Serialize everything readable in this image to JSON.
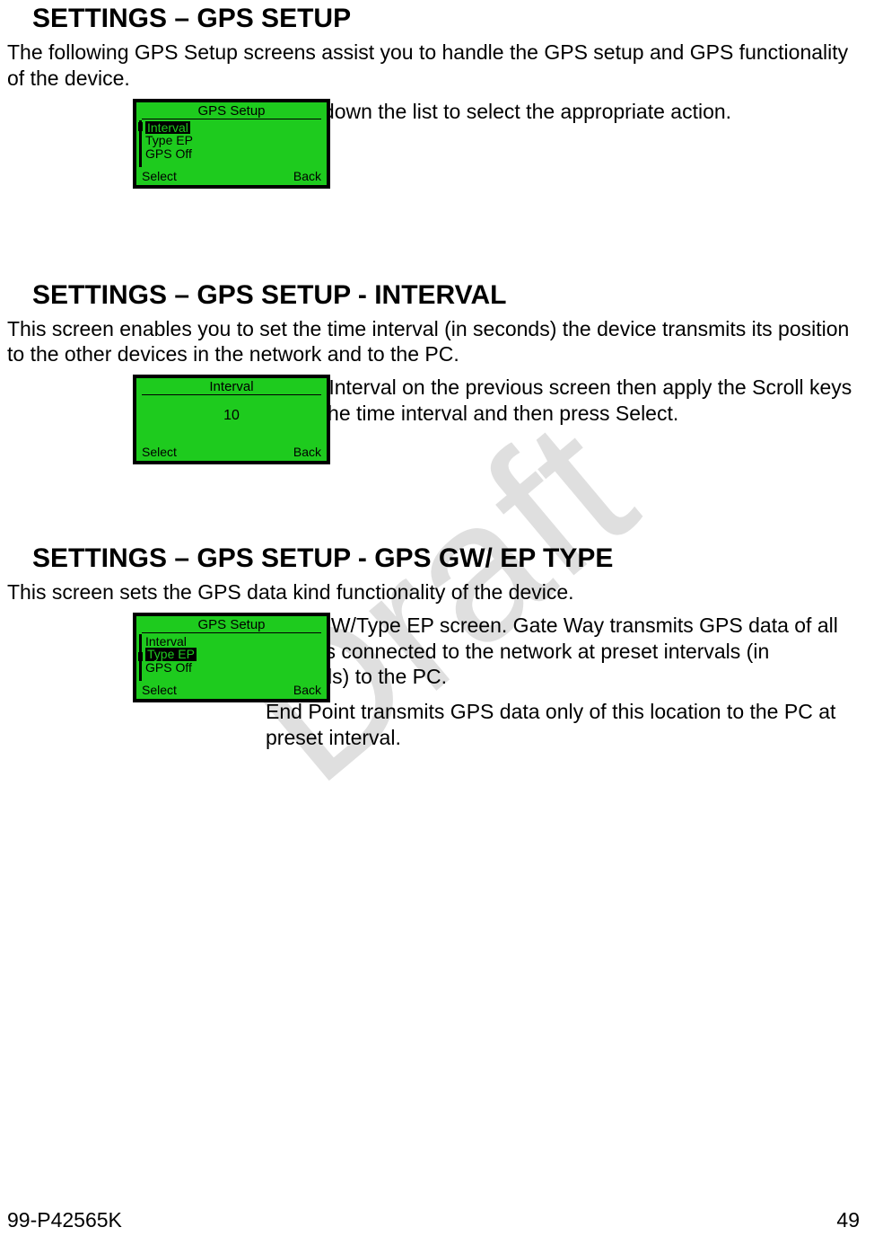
{
  "watermark": "Draft",
  "sections": [
    {
      "heading": "SETTINGS – GPS SETUP",
      "body": "The following GPS Setup screens assist you to handle the GPS setup and GPS functionality of the device.",
      "lcd": {
        "title": "GPS Setup",
        "items": [
          "Interval",
          "Type EP",
          "GPS Off"
        ],
        "selected_index": 0,
        "left_soft": "Select",
        "right_soft": "Back"
      },
      "caption": [
        "Scroll down the list to select the appropriate action."
      ]
    },
    {
      "heading": "SETTINGS – GPS SETUP - INTERVAL",
      "body": "This screen enables you to set the time interval (in seconds) the device transmits its position to the other devices in the network and to the PC.",
      "lcd": {
        "title": "Interval",
        "value": "10",
        "left_soft": "Select",
        "right_soft": "Back"
      },
      "caption": [
        "Select Interval   on the previous screen then apply the Scroll keys to set the time interval and then press Select."
      ]
    },
    {
      "heading": "SETTINGS – GPS SETUP - GPS GW/ EP TYPE",
      "body": "This screen sets the GPS data kind functionality of the device.",
      "lcd": {
        "title": "GPS Setup",
        "items": [
          "Interval",
          "Type EP",
          "GPS Off"
        ],
        "selected_index": 1,
        "left_soft": "Select",
        "right_soft": "Back"
      },
      "caption": [
        "GPS GW/Type EP screen. Gate Way transmits GPS data of all devices connected to the network at preset intervals (in seconds) to the PC.",
        "End Point transmits GPS data only of this location to the PC at preset interval."
      ]
    }
  ],
  "footer": {
    "doc_number": "99-P42565K",
    "page": "49"
  }
}
